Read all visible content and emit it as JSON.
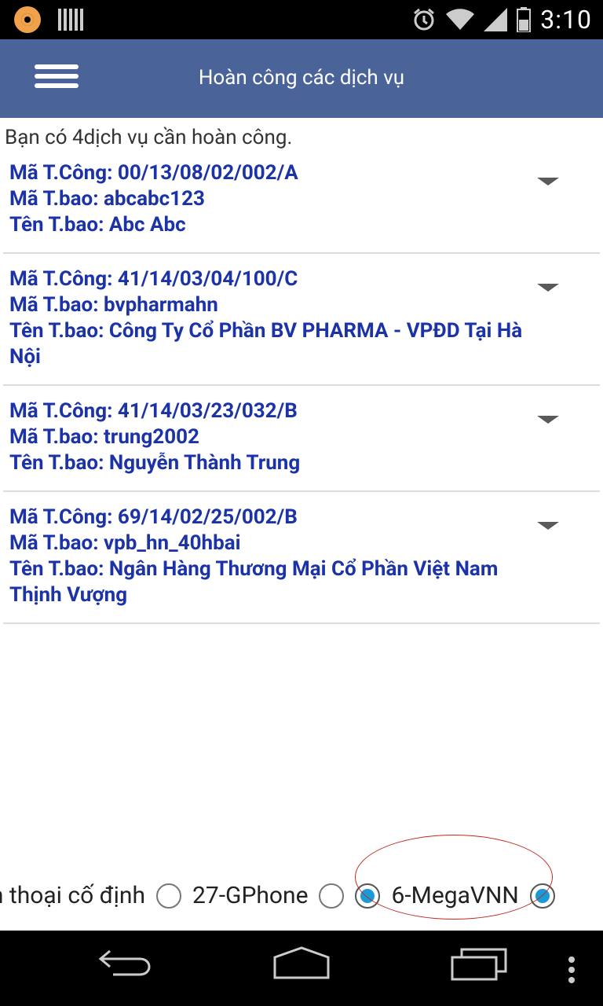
{
  "status_bar": {
    "time": "3:10",
    "icons": [
      "app-notification-icon",
      "barcode-icon",
      "alarm-icon",
      "wifi-icon",
      "signal-icon",
      "battery-icon"
    ]
  },
  "app_bar": {
    "title": "Hoàn công các dịch vụ",
    "menu_icon": "hamburger-menu-icon"
  },
  "intro_text": "Bạn có 4dịch vụ cần hoàn công.",
  "services": [
    {
      "ma_tcong": "Mã T.Công: 00/13/08/02/002/A",
      "ma_tbao": "Mã T.bao: abcabc123",
      "ten_tbao": "Tên T.bao: Abc Abc"
    },
    {
      "ma_tcong": "Mã T.Công: 41/14/03/04/100/C",
      "ma_tbao": "Mã T.bao: bvpharmahn",
      "ten_tbao": "Tên T.bao: Công Ty Cổ Phần BV PHARMA - VPĐD Tại Hà Nội"
    },
    {
      "ma_tcong": "Mã T.Công: 41/14/03/23/032/B",
      "ma_tbao": "Mã T.bao: trung2002",
      "ten_tbao": "Tên T.bao: Nguyễn Thành Trung"
    },
    {
      "ma_tcong": "Mã T.Công: 69/14/02/25/002/B",
      "ma_tbao": "Mã T.bao: vpb_hn_40hbai",
      "ten_tbao": "Tên T.bao: Ngân Hàng Thương Mại Cổ Phần Việt Nam Thịnh Vượng"
    }
  ],
  "service_filters": {
    "options": [
      "ện thoại cố định",
      "27-GPhone",
      "6-MegaVNN",
      ""
    ],
    "selected": "6-MegaVNN"
  },
  "colors": {
    "app_bar": "#4a6399",
    "item_text": "#1c33a8",
    "radio_selected": "#1a9ad6",
    "annotation": "#c0281e"
  }
}
